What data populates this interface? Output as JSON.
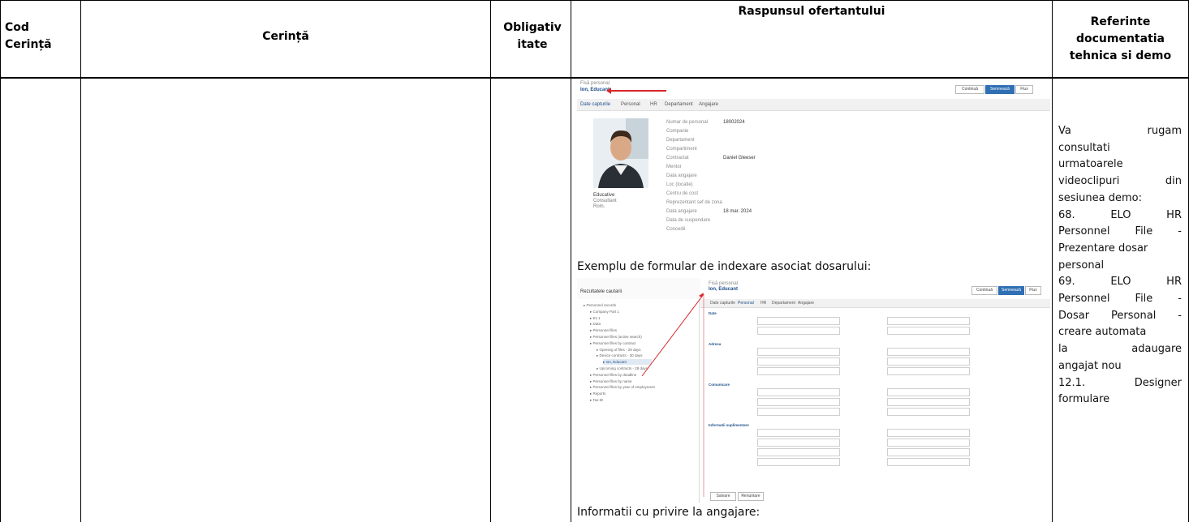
{
  "table": {
    "headers": {
      "cod": "Cod Cerință",
      "cerinta": "Cerință",
      "obligativitate": "Obligativ itate",
      "raspuns": "Raspunsul ofertantului",
      "referinte": "Referinte documentatia tehnica si demo"
    }
  },
  "screenshot1": {
    "record_type": "Fisă personal",
    "employee_name": "Ion, Educant",
    "buttons": [
      "Continuă",
      "Semnează",
      "Flux"
    ],
    "tabs": [
      "Date capturile",
      "Personal",
      "HR",
      "Departament",
      "Angajare"
    ],
    "person_caption": [
      "Educative",
      "Consultant",
      "Rom."
    ],
    "fields": [
      {
        "label": "Numar de personal",
        "value": "18002024"
      },
      {
        "label": "Companie",
        "value": ""
      },
      {
        "label": "Departament",
        "value": ""
      },
      {
        "label": "Compartiment",
        "value": ""
      },
      {
        "label": "Contractat",
        "value": "Daniel Gleeser"
      },
      {
        "label": "Mentor",
        "value": ""
      },
      {
        "label": "Data angajare",
        "value": ""
      },
      {
        "label": "Loc (locatie)",
        "value": ""
      },
      {
        "label": "Centru de cost",
        "value": ""
      },
      {
        "label": "Reprezentant sef de zona",
        "value": ""
      },
      {
        "label": "Data angajare",
        "value": "18 mar. 2024"
      },
      {
        "label": "Data de suspendare",
        "value": ""
      },
      {
        "label": "Concedii",
        "value": ""
      }
    ]
  },
  "caption1": "Exemplu de formular de indexare asociat dosarului:",
  "screenshot2": {
    "panel_title": "Rezultatele cautarii",
    "record_type": "Fisă personal",
    "employee_name": "Ion, Educant",
    "buttons": [
      "Continuă",
      "Semnează",
      "Flux"
    ],
    "tabs": [
      "Date capturile",
      "Personal",
      "HR",
      "Departament",
      "Angajare"
    ],
    "tree": [
      "Personnel records",
      "Company Part 1",
      "E1.1",
      "Data",
      "Personnel files",
      "Personnel files (active search)",
      "Personnel files by contract",
      "Opening of files - 29 days",
      "Device contracts - 30 days",
      "Ion, Educant",
      "Upcoming contracts - 28 days",
      "Personnel files by deadline",
      "Personnel files by name",
      "Personnel files by year of employment",
      "Reports",
      "Tax:ID"
    ],
    "sections": [
      "Date",
      "Adresa",
      "Comunicare",
      "Informatii suplimentare"
    ],
    "footer_buttons": [
      "Salvare",
      "Renuntare"
    ]
  },
  "caption2": "Informatii cu privire la angajare:",
  "references": {
    "lines": [
      [
        "Va",
        "rugam"
      ],
      [
        "consultati"
      ],
      [
        "urmatoarele"
      ],
      [
        "videoclipuri",
        "din"
      ],
      [
        "sesiunea demo:"
      ],
      [
        "68.",
        "ELO",
        "HR"
      ],
      [
        "Personnel",
        "File",
        "-"
      ],
      [
        "Prezentare dosar"
      ],
      [
        "personal"
      ],
      [
        "69.",
        "ELO",
        "HR"
      ],
      [
        "Personnel",
        "File",
        "-"
      ],
      [
        "Dosar",
        "Personal",
        "-"
      ],
      [
        "creare automata"
      ],
      [
        "la",
        "adaugare"
      ],
      [
        "angajat nou"
      ],
      [
        "12.1.",
        "Designer"
      ],
      [
        "formulare"
      ]
    ]
  },
  "colors": {
    "arrow": "#d8262a",
    "primary": "#2f6fb3"
  }
}
